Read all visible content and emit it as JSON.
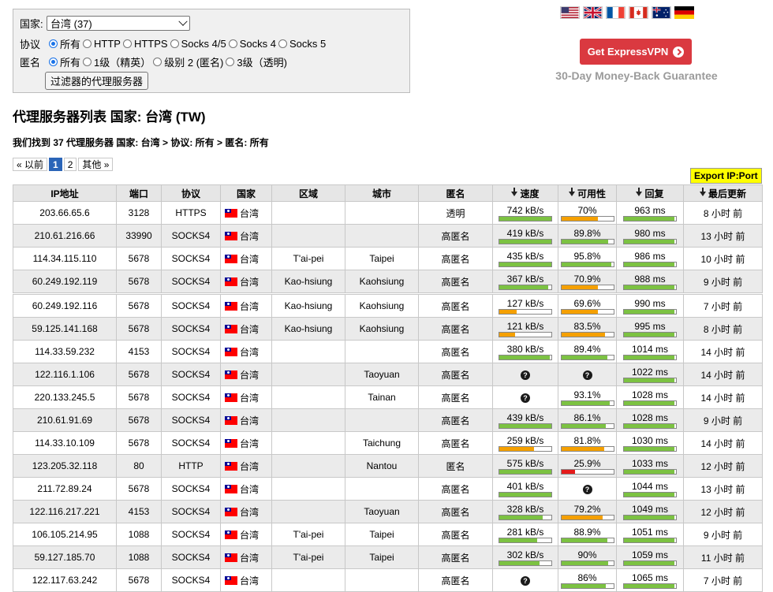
{
  "filters": {
    "country_label": "国家:",
    "country_selected": "台湾 (37)",
    "protocol_label": "协议",
    "protocols": [
      "所有",
      "HTTP",
      "HTTPS",
      "Socks 4/5",
      "Socks 4",
      "Socks 5"
    ],
    "protocol_selected": 0,
    "anon_label": "匿名",
    "anon_levels": [
      "所有",
      "1级（精英）",
      "级别 2 (匿名)",
      "3级（透明)"
    ],
    "anon_selected": 0,
    "submit_label": "过滤器的代理服务器"
  },
  "flags": [
    "us-flag",
    "uk-flag",
    "fr-flag",
    "ca-flag",
    "au-flag",
    "de-flag"
  ],
  "promo": {
    "button_label": "Get ExpressVPN",
    "guarantee": "30-Day Money-Back Guarantee",
    "color": "#da3940"
  },
  "page_title": "代理服务器列表 国家: 台湾 (TW)",
  "summary": "我们找到 37 代理服务器 国家: 台湾 > 协议: 所有 > 匿名: 所有",
  "pager": {
    "prev": "« 以前",
    "pages": [
      "1",
      "2"
    ],
    "current": 0,
    "other": "其他 »"
  },
  "export_label": "Export IP:Port",
  "colors": {
    "good": "#7cc242",
    "medium": "#f5a000",
    "bad": "#e51a1a",
    "header": "#e6e6e6"
  },
  "table": {
    "headers": [
      "IP地址",
      "端口",
      "协议",
      "国家",
      "区域",
      "城市",
      "匿名",
      "速度",
      "可用性",
      "回复",
      "最后更新"
    ],
    "sortable": [
      false,
      false,
      false,
      false,
      false,
      false,
      false,
      true,
      true,
      true,
      true
    ],
    "rows": [
      {
        "ip": "203.66.65.6",
        "port": "3128",
        "proto": "HTTPS",
        "country": "台湾",
        "region": "",
        "city": "",
        "anon": "透明",
        "speed": "742 kB/s",
        "speed_level": 1.0,
        "speed_color": "good",
        "up": "70%",
        "up_level": 0.7,
        "up_color": "medium",
        "resp": "963 ms",
        "resp_level": 0.97,
        "updated": "8 小时 前"
      },
      {
        "ip": "210.61.216.66",
        "port": "33990",
        "proto": "SOCKS4",
        "country": "台湾",
        "region": "",
        "city": "",
        "anon": "高匿名",
        "speed": "419 kB/s",
        "speed_level": 1.0,
        "speed_color": "good",
        "up": "89.8%",
        "up_level": 0.9,
        "up_color": "good",
        "resp": "980 ms",
        "resp_level": 0.97,
        "updated": "13 小时 前"
      },
      {
        "ip": "114.34.115.110",
        "port": "5678",
        "proto": "SOCKS4",
        "country": "台湾",
        "region": "T'ai-pei",
        "city": "Taipei",
        "anon": "高匿名",
        "speed": "435 kB/s",
        "speed_level": 1.0,
        "speed_color": "good",
        "up": "95.8%",
        "up_level": 0.96,
        "up_color": "good",
        "resp": "986 ms",
        "resp_level": 0.97,
        "updated": "10 小时 前"
      },
      {
        "ip": "60.249.192.119",
        "port": "5678",
        "proto": "SOCKS4",
        "country": "台湾",
        "region": "Kao-hsiung",
        "city": "Kaohsiung",
        "anon": "高匿名",
        "speed": "367 kB/s",
        "speed_level": 0.94,
        "speed_color": "good",
        "up": "70.9%",
        "up_level": 0.71,
        "up_color": "medium",
        "resp": "988 ms",
        "resp_level": 0.97,
        "updated": "9 小时 前"
      },
      {
        "ip": "60.249.192.116",
        "port": "5678",
        "proto": "SOCKS4",
        "country": "台湾",
        "region": "Kao-hsiung",
        "city": "Kaohsiung",
        "anon": "高匿名",
        "speed": "127 kB/s",
        "speed_level": 0.33,
        "speed_color": "medium",
        "up": "69.6%",
        "up_level": 0.7,
        "up_color": "medium",
        "resp": "990 ms",
        "resp_level": 0.97,
        "updated": "7 小时 前"
      },
      {
        "ip": "59.125.141.168",
        "port": "5678",
        "proto": "SOCKS4",
        "country": "台湾",
        "region": "Kao-hsiung",
        "city": "Kaohsiung",
        "anon": "高匿名",
        "speed": "121 kB/s",
        "speed_level": 0.31,
        "speed_color": "medium",
        "up": "83.5%",
        "up_level": 0.84,
        "up_color": "medium",
        "resp": "995 ms",
        "resp_level": 0.97,
        "updated": "8 小时 前"
      },
      {
        "ip": "114.33.59.232",
        "port": "4153",
        "proto": "SOCKS4",
        "country": "台湾",
        "region": "",
        "city": "",
        "anon": "高匿名",
        "speed": "380 kB/s",
        "speed_level": 0.97,
        "speed_color": "good",
        "up": "89.4%",
        "up_level": 0.89,
        "up_color": "good",
        "resp": "1014 ms",
        "resp_level": 0.97,
        "updated": "14 小时 前"
      },
      {
        "ip": "122.116.1.106",
        "port": "5678",
        "proto": "SOCKS4",
        "country": "台湾",
        "region": "",
        "city": "Taoyuan",
        "anon": "高匿名",
        "speed": "?",
        "speed_level": null,
        "speed_color": "good",
        "up": "?",
        "up_level": null,
        "up_color": "good",
        "resp": "1022 ms",
        "resp_level": 0.97,
        "updated": "14 小时 前"
      },
      {
        "ip": "220.133.245.5",
        "port": "5678",
        "proto": "SOCKS4",
        "country": "台湾",
        "region": "",
        "city": "Tainan",
        "anon": "高匿名",
        "speed": "?",
        "speed_level": null,
        "speed_color": "good",
        "up": "93.1%",
        "up_level": 0.93,
        "up_color": "good",
        "resp": "1028 ms",
        "resp_level": 0.97,
        "updated": "14 小时 前"
      },
      {
        "ip": "210.61.91.69",
        "port": "5678",
        "proto": "SOCKS4",
        "country": "台湾",
        "region": "",
        "city": "",
        "anon": "高匿名",
        "speed": "439 kB/s",
        "speed_level": 1.0,
        "speed_color": "good",
        "up": "86.1%",
        "up_level": 0.86,
        "up_color": "good",
        "resp": "1028 ms",
        "resp_level": 0.97,
        "updated": "9 小时 前"
      },
      {
        "ip": "114.33.10.109",
        "port": "5678",
        "proto": "SOCKS4",
        "country": "台湾",
        "region": "",
        "city": "Taichung",
        "anon": "高匿名",
        "speed": "259 kB/s",
        "speed_level": 0.66,
        "speed_color": "medium",
        "up": "81.8%",
        "up_level": 0.82,
        "up_color": "medium",
        "resp": "1030 ms",
        "resp_level": 0.97,
        "updated": "14 小时 前"
      },
      {
        "ip": "123.205.32.118",
        "port": "80",
        "proto": "HTTP",
        "country": "台湾",
        "region": "",
        "city": "Nantou",
        "anon": "匿名",
        "speed": "575 kB/s",
        "speed_level": 1.0,
        "speed_color": "good",
        "up": "25.9%",
        "up_level": 0.26,
        "up_color": "bad",
        "resp": "1033 ms",
        "resp_level": 0.97,
        "updated": "12 小时 前"
      },
      {
        "ip": "211.72.89.24",
        "port": "5678",
        "proto": "SOCKS4",
        "country": "台湾",
        "region": "",
        "city": "",
        "anon": "高匿名",
        "speed": "401 kB/s",
        "speed_level": 1.0,
        "speed_color": "good",
        "up": "?",
        "up_level": null,
        "up_color": "good",
        "resp": "1044 ms",
        "resp_level": 0.97,
        "updated": "13 小时 前"
      },
      {
        "ip": "122.116.217.221",
        "port": "4153",
        "proto": "SOCKS4",
        "country": "台湾",
        "region": "",
        "city": "Taoyuan",
        "anon": "高匿名",
        "speed": "328 kB/s",
        "speed_level": 0.84,
        "speed_color": "good",
        "up": "79.2%",
        "up_level": 0.79,
        "up_color": "medium",
        "resp": "1049 ms",
        "resp_level": 0.97,
        "updated": "12 小时 前"
      },
      {
        "ip": "106.105.214.95",
        "port": "1088",
        "proto": "SOCKS4",
        "country": "台湾",
        "region": "T'ai-pei",
        "city": "Taipei",
        "anon": "高匿名",
        "speed": "281 kB/s",
        "speed_level": 0.72,
        "speed_color": "good",
        "up": "88.9%",
        "up_level": 0.89,
        "up_color": "good",
        "resp": "1051 ms",
        "resp_level": 0.97,
        "updated": "9 小时 前"
      },
      {
        "ip": "59.127.185.70",
        "port": "1088",
        "proto": "SOCKS4",
        "country": "台湾",
        "region": "T'ai-pei",
        "city": "Taipei",
        "anon": "高匿名",
        "speed": "302 kB/s",
        "speed_level": 0.77,
        "speed_color": "good",
        "up": "90%",
        "up_level": 0.9,
        "up_color": "good",
        "resp": "1059 ms",
        "resp_level": 0.97,
        "updated": "11 小时 前"
      },
      {
        "ip": "122.117.63.242",
        "port": "5678",
        "proto": "SOCKS4",
        "country": "台湾",
        "region": "",
        "city": "",
        "anon": "高匿名",
        "speed": "?",
        "speed_level": null,
        "speed_color": "good",
        "up": "86%",
        "up_level": 0.86,
        "up_color": "good",
        "resp": "1065 ms",
        "resp_level": 0.97,
        "updated": "7 小时 前"
      }
    ]
  }
}
